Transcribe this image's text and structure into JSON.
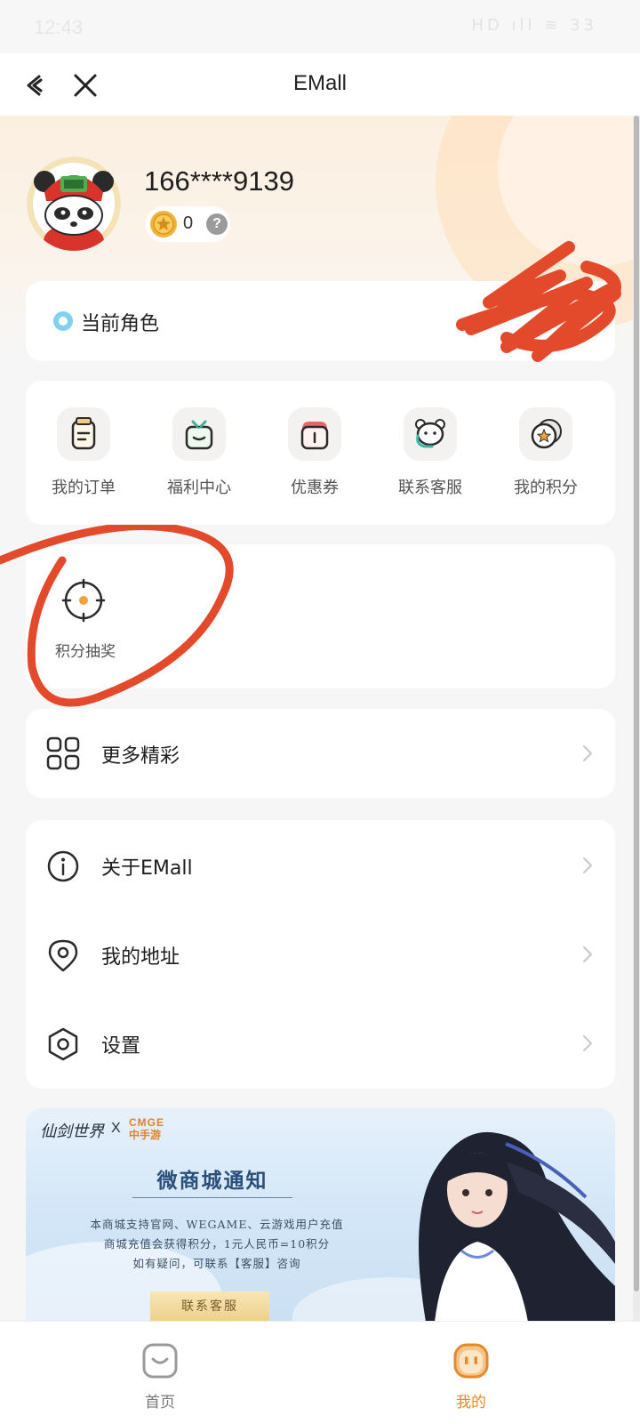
{
  "status_bar": {
    "time": "12:43",
    "icons": "HD ıll ≋ 33"
  },
  "title_bar": {
    "title": "EMall"
  },
  "profile": {
    "phone": "166****9139",
    "points": "0",
    "help": "?"
  },
  "role": {
    "label": "当前角色"
  },
  "quick_actions": [
    {
      "label": "我的订单",
      "icon": "order-icon"
    },
    {
      "label": "福利中心",
      "icon": "gift-icon"
    },
    {
      "label": "优惠券",
      "icon": "coupon-icon"
    },
    {
      "label": "联系客服",
      "icon": "customer-service-icon"
    },
    {
      "label": "我的积分",
      "icon": "points-icon"
    }
  ],
  "lottery": {
    "label": "积分抽奖",
    "icon": "lottery-icon"
  },
  "more": {
    "label": "更多精彩",
    "icon": "grid-icon"
  },
  "menu": [
    {
      "label": "关于EMall",
      "icon": "info-icon"
    },
    {
      "label": "我的地址",
      "icon": "location-icon"
    },
    {
      "label": "设置",
      "icon": "settings-icon"
    }
  ],
  "banner": {
    "game_logo": "仙剑世界",
    "x": "X",
    "brand_en": "CMGE",
    "brand_cn": "中手游",
    "title": "微商城通知",
    "lines": [
      "本商城支持官网、WEGAME、云游戏用户充值",
      "商城充值会获得积分，1元人民币=10积分",
      "如有疑问，可联系【客服】咨询"
    ],
    "button": "联系客服"
  },
  "tabs": [
    {
      "label": "首页",
      "active": false
    },
    {
      "label": "我的",
      "active": true
    }
  ],
  "colors": {
    "accent": "#e38a2c",
    "annotation": "#e24a2b",
    "role_dot": "#7fd1ec"
  }
}
